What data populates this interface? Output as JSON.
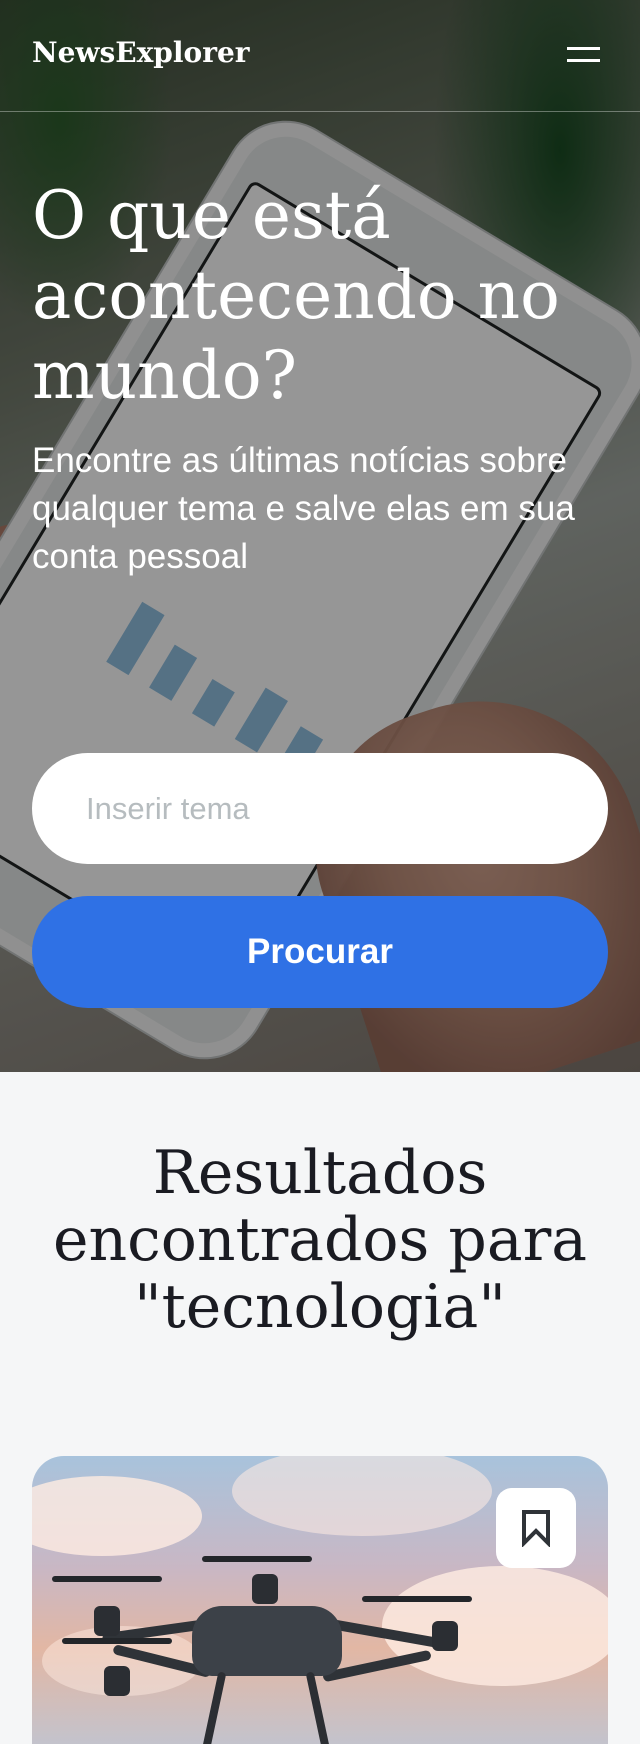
{
  "header": {
    "logo": "NewsExplorer",
    "menu_icon": "hamburger-menu-icon"
  },
  "hero": {
    "title": "O que está acontecendo no mundo?",
    "subtitle": "Encontre as últimas notícias sobre qualquer tema e salve elas em sua conta pessoal",
    "search_placeholder": "Inserir tema",
    "search_value": "",
    "search_button": "Procurar"
  },
  "results": {
    "title": "Resultados encontrados para \"tecnologia\"",
    "cards": [
      {
        "image": "drone-photo",
        "bookmark_icon": "bookmark-icon"
      }
    ]
  },
  "colors": {
    "accent": "#2f71e5",
    "background": "#f5f6f7",
    "text": "#1a1b22",
    "placeholder": "#b6bcbf"
  }
}
